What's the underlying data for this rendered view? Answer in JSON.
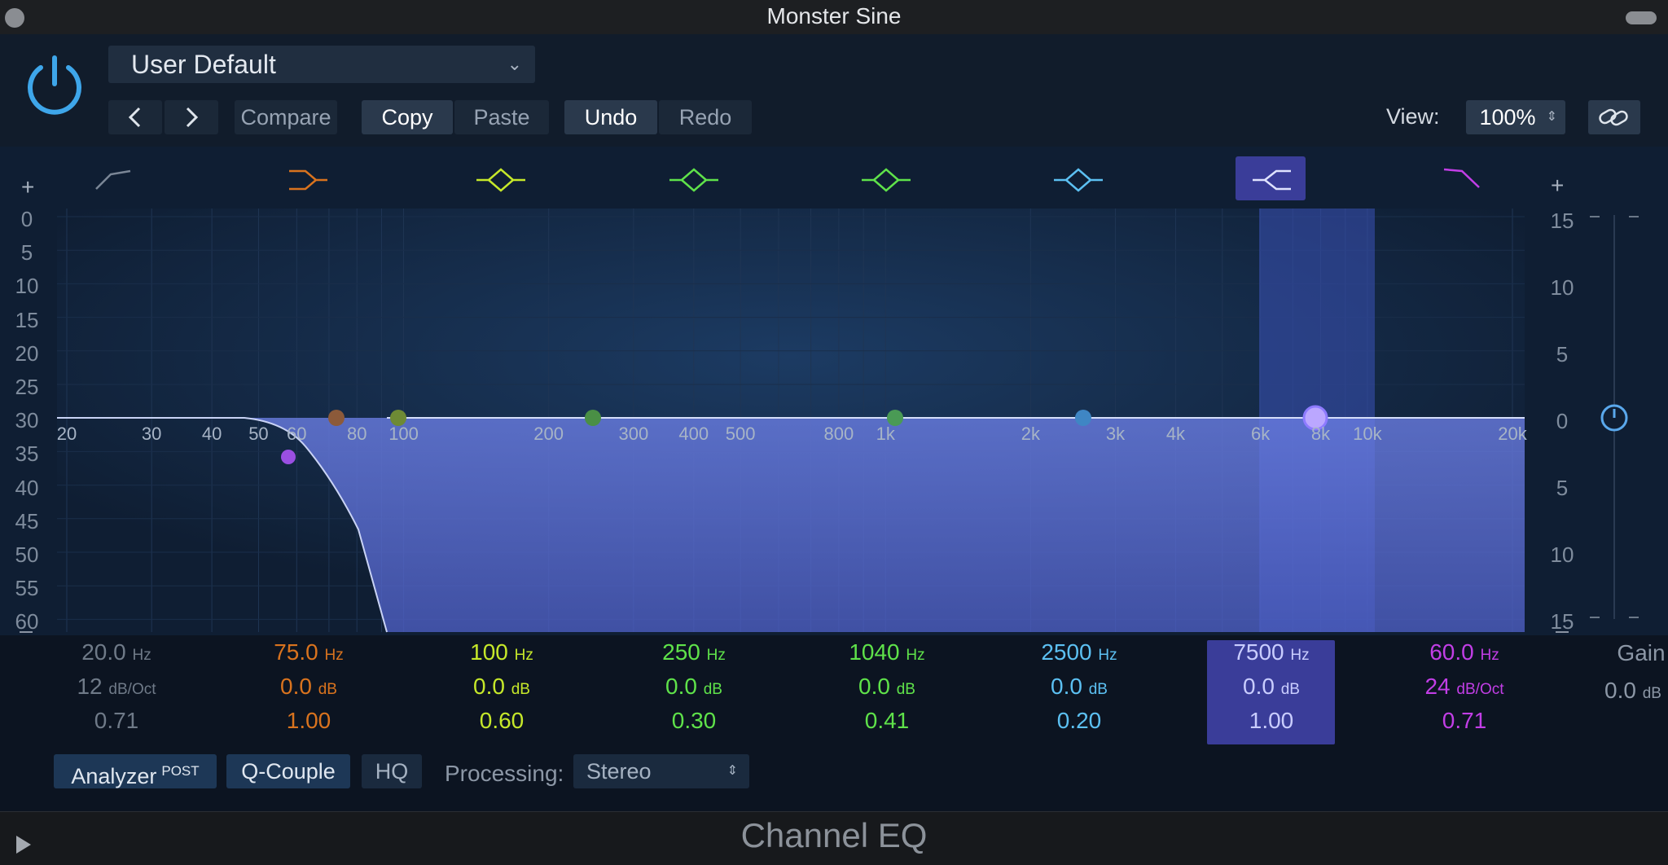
{
  "window": {
    "title": "Monster Sine"
  },
  "header": {
    "preset": "User Default",
    "compare": "Compare",
    "copy": "Copy",
    "paste": "Paste",
    "undo": "Undo",
    "redo": "Redo",
    "view_label": "View:",
    "view_value": "100%"
  },
  "plot": {
    "plus_left": "+",
    "plus_right": "+",
    "db_scale_left": [
      "0",
      "5",
      "10",
      "15",
      "20",
      "25",
      "30",
      "35",
      "40",
      "45",
      "50",
      "55",
      "60"
    ],
    "gain_scale_right": [
      "15",
      "10",
      "5",
      "0",
      "5",
      "10",
      "15"
    ],
    "freq_labels": [
      "20",
      "30",
      "40",
      "50",
      "60",
      "80",
      "100",
      "200",
      "300",
      "400",
      "500",
      "800",
      "1k",
      "2k",
      "3k",
      "4k",
      "6k",
      "8k",
      "10k",
      "20k"
    ]
  },
  "bands": [
    {
      "freq": "20.0",
      "freq_unit": "Hz",
      "gain": "12",
      "gain_unit": "dB/Oct",
      "q": "0.71",
      "color": "#6f7a88",
      "type": "low-cut"
    },
    {
      "freq": "75.0",
      "freq_unit": "Hz",
      "gain": "0.0",
      "gain_unit": "dB",
      "q": "1.00",
      "color": "#d9731e",
      "type": "low-shelf"
    },
    {
      "freq": "100",
      "freq_unit": "Hz",
      "gain": "0.0",
      "gain_unit": "dB",
      "q": "0.60",
      "color": "#c6e82a",
      "type": "bell"
    },
    {
      "freq": "250",
      "freq_unit": "Hz",
      "gain": "0.0",
      "gain_unit": "dB",
      "q": "0.30",
      "color": "#5fe24a",
      "type": "bell"
    },
    {
      "freq": "1040",
      "freq_unit": "Hz",
      "gain": "0.0",
      "gain_unit": "dB",
      "q": "0.41",
      "color": "#5fe24a",
      "type": "bell"
    },
    {
      "freq": "2500",
      "freq_unit": "Hz",
      "gain": "0.0",
      "gain_unit": "dB",
      "q": "0.20",
      "color": "#5cc0f2",
      "type": "bell"
    },
    {
      "freq": "7500",
      "freq_unit": "Hz",
      "gain": "0.0",
      "gain_unit": "dB",
      "q": "1.00",
      "color": "#9fa8ff",
      "type": "high-shelf"
    },
    {
      "freq": "60.0",
      "freq_unit": "Hz",
      "gain": "24",
      "gain_unit": "dB/Oct",
      "q": "0.71",
      "color": "#c23ee6",
      "type": "high-cut"
    }
  ],
  "gain": {
    "label": "Gain",
    "value": "0.0",
    "unit": "dB"
  },
  "bottom": {
    "analyzer": "Analyzer",
    "analyzer_sup": "POST",
    "qcouple": "Q-Couple",
    "hq": "HQ",
    "processing_label": "Processing:",
    "processing_value": "Stereo"
  },
  "footer": {
    "title": "Channel EQ"
  }
}
